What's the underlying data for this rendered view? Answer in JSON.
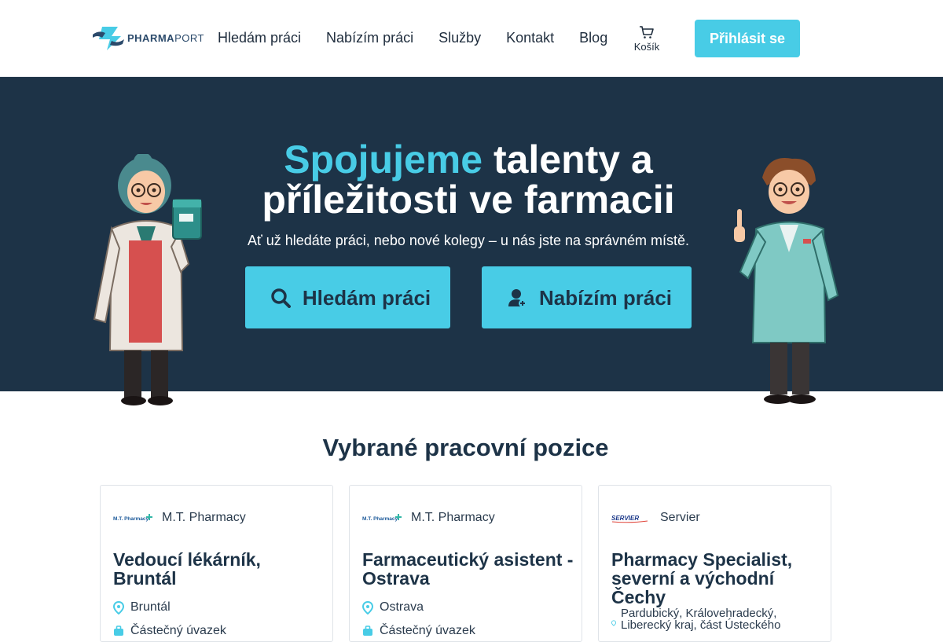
{
  "header": {
    "logo": {
      "brand_bold": "PHARMA",
      "brand_light": "PORT"
    },
    "nav": [
      "Hledám práci",
      "Nabízím práci",
      "Služby",
      "Kontakt",
      "Blog"
    ],
    "cart_label": "Košík",
    "login_label": "Přihlásit se"
  },
  "hero": {
    "title_accent": "Spojujeme",
    "title_rest_1": " talenty a",
    "title_rest_2": "příležitosti ve farmacii",
    "subtitle": "Ať už hledáte práci, nebo nové kolegy – u nás jste na správném místě.",
    "btn_seek_label": "Hledám práci",
    "btn_offer_label": "Nabízím práci"
  },
  "jobs": {
    "section_title": "Vybrané pracovní pozice",
    "cards": [
      {
        "company": "M.T. Pharmacy",
        "logo_text": "M.T. Pharmacy",
        "title": "Vedoucí lékárník, Bruntál",
        "location": "Bruntál",
        "meta": "Částečný úvazek"
      },
      {
        "company": "M.T. Pharmacy",
        "logo_text": "M.T. Pharmacy",
        "title": "Farmaceutický asistent - Ostrava",
        "location": "Ostrava",
        "meta": "Částečný úvazek"
      },
      {
        "company": "Servier",
        "logo_text": "SERVIER",
        "title": "Pharmacy Specialist, severní a východní Čechy",
        "location": "Pardubický, Královehradecký, Liberecký kraj, část Ústeckého"
      }
    ]
  },
  "colors": {
    "accent": "#48cce6",
    "hero_bg": "#1d3347",
    "heading": "#1d3347"
  },
  "icons": [
    "cart-icon",
    "search-icon",
    "user-plus-icon",
    "map-pin-icon",
    "briefcase-icon"
  ]
}
